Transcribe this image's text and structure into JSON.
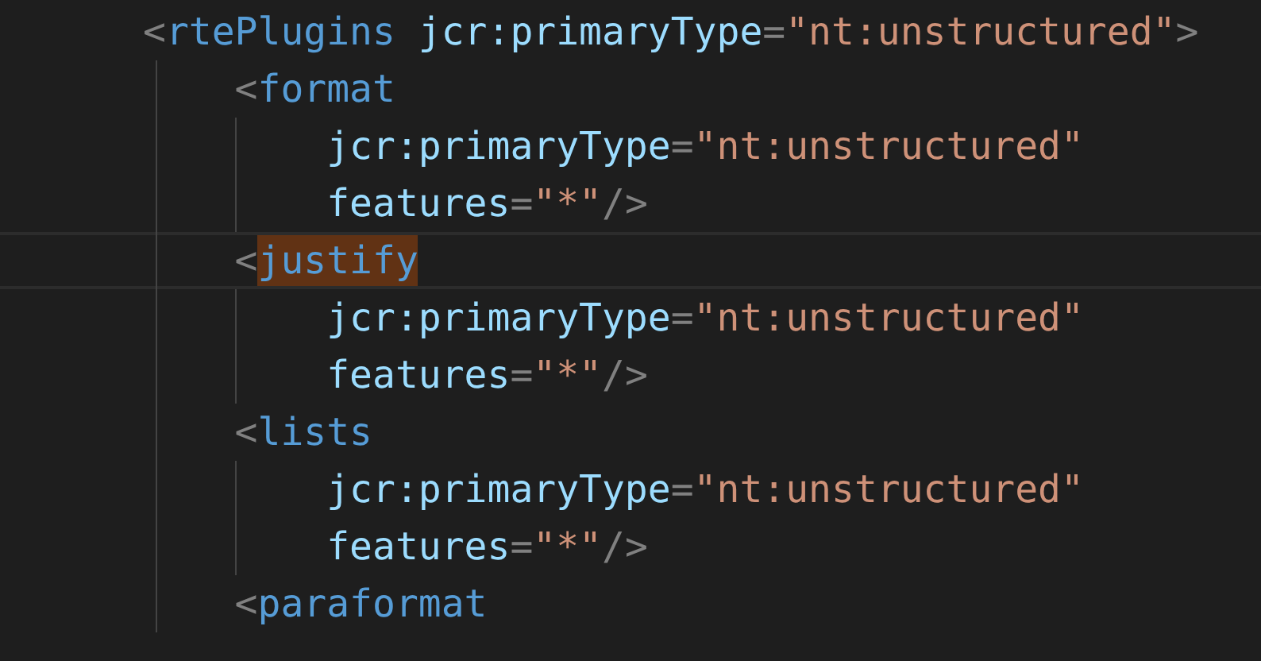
{
  "editor": {
    "lines": [
      {
        "current": false,
        "tokens": [
          {
            "kind": "punct",
            "text": "<",
            "highlighted": false
          },
          {
            "kind": "tag",
            "text": "rtePlugins",
            "highlighted": false
          },
          {
            "kind": "attr",
            "text": " jcr:primaryType",
            "highlighted": false
          },
          {
            "kind": "punct",
            "text": "=",
            "highlighted": false
          },
          {
            "kind": "string",
            "text": "\"nt:unstructured\"",
            "highlighted": false
          },
          {
            "kind": "punct",
            "text": ">",
            "highlighted": false
          }
        ],
        "children": [
          {
            "current": false,
            "tokens": [
              {
                "kind": "punct",
                "text": "<",
                "highlighted": false
              },
              {
                "kind": "tag",
                "text": "format",
                "highlighted": false
              }
            ],
            "children": [
              {
                "current": false,
                "tokens": [
                  {
                    "kind": "attr",
                    "text": "jcr:primaryType"
                  },
                  {
                    "kind": "punct",
                    "text": "="
                  },
                  {
                    "kind": "string",
                    "text": "\"nt:unstructured\""
                  }
                ]
              },
              {
                "current": false,
                "tokens": [
                  {
                    "kind": "attr",
                    "text": "features"
                  },
                  {
                    "kind": "punct",
                    "text": "="
                  },
                  {
                    "kind": "string",
                    "text": "\"*\""
                  },
                  {
                    "kind": "punct",
                    "text": "/>"
                  }
                ]
              }
            ]
          },
          {
            "current": true,
            "tokens": [
              {
                "kind": "punct",
                "text": "<",
                "highlighted": false
              },
              {
                "kind": "tag",
                "text": "justify",
                "highlighted": true
              }
            ],
            "children": [
              {
                "current": false,
                "tokens": [
                  {
                    "kind": "attr",
                    "text": "jcr:primaryType"
                  },
                  {
                    "kind": "punct",
                    "text": "="
                  },
                  {
                    "kind": "string",
                    "text": "\"nt:unstructured\""
                  }
                ]
              },
              {
                "current": false,
                "tokens": [
                  {
                    "kind": "attr",
                    "text": "features"
                  },
                  {
                    "kind": "punct",
                    "text": "="
                  },
                  {
                    "kind": "string",
                    "text": "\"*\""
                  },
                  {
                    "kind": "punct",
                    "text": "/>"
                  }
                ]
              }
            ]
          },
          {
            "current": false,
            "tokens": [
              {
                "kind": "punct",
                "text": "<",
                "highlighted": false
              },
              {
                "kind": "tag",
                "text": "lists",
                "highlighted": false
              }
            ],
            "children": [
              {
                "current": false,
                "tokens": [
                  {
                    "kind": "attr",
                    "text": "jcr:primaryType"
                  },
                  {
                    "kind": "punct",
                    "text": "="
                  },
                  {
                    "kind": "string",
                    "text": "\"nt:unstructured\""
                  }
                ]
              },
              {
                "current": false,
                "tokens": [
                  {
                    "kind": "attr",
                    "text": "features"
                  },
                  {
                    "kind": "punct",
                    "text": "="
                  },
                  {
                    "kind": "string",
                    "text": "\"*\""
                  },
                  {
                    "kind": "punct",
                    "text": "/>"
                  }
                ]
              }
            ]
          },
          {
            "current": false,
            "tokens": [
              {
                "kind": "punct",
                "text": "<",
                "highlighted": false
              },
              {
                "kind": "tag",
                "text": "paraformat",
                "highlighted": false
              }
            ]
          }
        ]
      }
    ]
  }
}
